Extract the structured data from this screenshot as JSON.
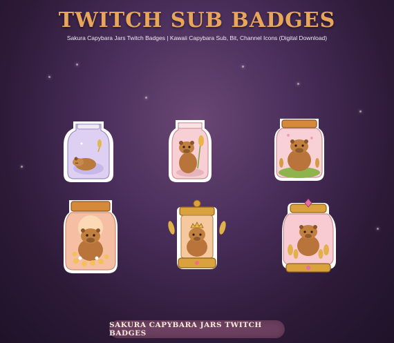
{
  "header": {
    "title": "TWITCH SUB BADGES",
    "subtitle": "Sakura Capybara Jars Twitch Badges | Kawaii Capybara Sub, Bit, Channel Icons (Digital Download)"
  },
  "footer": {
    "label": "SAKURA CAPYBARA JARS TWITCH BADGES"
  },
  "colors": {
    "background": "#4b2f5c",
    "title": "#e7a65a",
    "capybara": "#b8743a",
    "lid": "#d48a3a",
    "gold": "#d9a23c",
    "jar_pink": "#f7c8cf",
    "jar_lavender": "#d9ccf0"
  },
  "badges": [
    {
      "icon": "lavender-jar-sleeping-capybara-icon"
    },
    {
      "icon": "pink-jar-capybara-wheat-icon"
    },
    {
      "icon": "pink-jar-capybara-grass-icon"
    },
    {
      "icon": "pink-jar-capybara-flowers-icon"
    },
    {
      "icon": "gold-jar-capybara-crown-icon"
    },
    {
      "icon": "ornate-gold-jar-capybara-gem-icon"
    }
  ]
}
